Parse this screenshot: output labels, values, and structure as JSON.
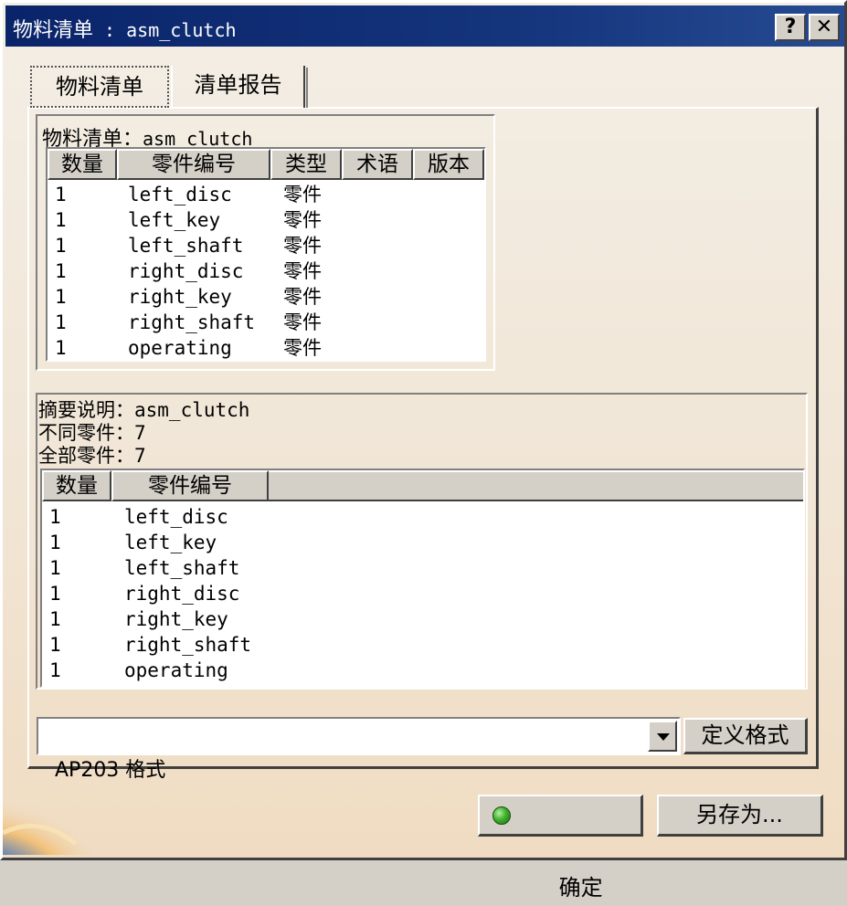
{
  "window": {
    "title": "物料清单",
    "title_sep": " : ",
    "title_name": "asm_clutch",
    "help_label": "?",
    "close_label": "✕"
  },
  "tabs": [
    {
      "label": "物料清单",
      "selected": true
    },
    {
      "label": "清单报告",
      "selected": false
    }
  ],
  "bom": {
    "title_label": "物料清单：",
    "title_value": "asm_clutch",
    "columns": [
      "数量",
      "零件编号",
      "类型",
      "术语",
      "版本"
    ],
    "rows": [
      {
        "qty": "1",
        "part": "left_disc",
        "type": "零件"
      },
      {
        "qty": "1",
        "part": "left_key",
        "type": "零件"
      },
      {
        "qty": "1",
        "part": "left_shaft",
        "type": "零件"
      },
      {
        "qty": "1",
        "part": "right_disc",
        "type": "零件"
      },
      {
        "qty": "1",
        "part": "right_key",
        "type": "零件"
      },
      {
        "qty": "1",
        "part": "right_shaft",
        "type": "零件"
      },
      {
        "qty": "1",
        "part": "operating",
        "type": "零件"
      }
    ]
  },
  "summary": {
    "desc_label": "摘要说明：",
    "desc_value": "asm_clutch",
    "distinct_label": "不同零件：",
    "distinct_value": "7",
    "total_label": "全部零件：",
    "total_value": "7",
    "columns": [
      "数量",
      "零件编号"
    ],
    "rows": [
      {
        "qty": "1",
        "part": "left_disc"
      },
      {
        "qty": "1",
        "part": "left_key"
      },
      {
        "qty": "1",
        "part": "left_shaft"
      },
      {
        "qty": "1",
        "part": "right_disc"
      },
      {
        "qty": "1",
        "part": "right_key"
      },
      {
        "qty": "1",
        "part": "right_shaft"
      },
      {
        "qty": "1",
        "part": "operating"
      }
    ]
  },
  "format": {
    "selected": "AP203 格式",
    "define_button": "定义格式"
  },
  "buttons": {
    "ok": "确定",
    "save_as": "另存为..."
  },
  "colors": {
    "titlebar": "#0a246a",
    "panel_bg": "#f1e6d6",
    "button_face": "#d4d0c8",
    "ok_icon": "#3fb12b"
  }
}
